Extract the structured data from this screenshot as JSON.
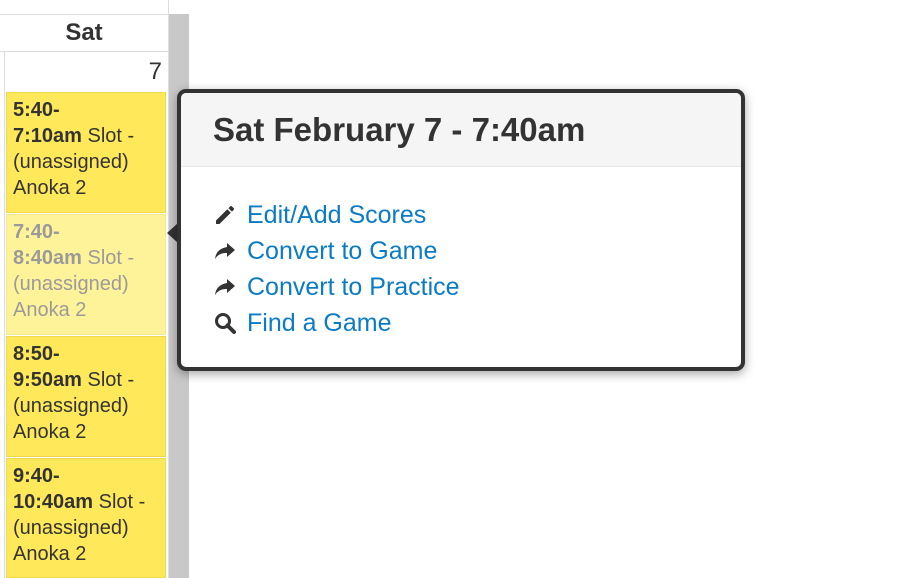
{
  "calendar": {
    "day_header": "Sat",
    "day_number": "7",
    "events": [
      {
        "time": "5:40-7:10am",
        "time_l1": "5:40-",
        "time_l2": "7:10am",
        "label": "Slot -",
        "status": "(unassigned)",
        "location": "Anoka 2"
      },
      {
        "time": "7:40-8:40am",
        "time_l1": "7:40-",
        "time_l2": "8:40am",
        "label": "Slot -",
        "status": "(unassigned)",
        "location": "Anoka 2"
      },
      {
        "time": "8:50-9:50am",
        "time_l1": "8:50-",
        "time_l2": "9:50am",
        "label": "Slot -",
        "status": "(unassigned)",
        "location": "Anoka 2"
      },
      {
        "time": "9:40-10:40am",
        "time_l1": "9:40-",
        "time_l2": "10:40am",
        "label": "Slot -",
        "status": "(unassigned)",
        "location": "Anoka 2"
      }
    ]
  },
  "popover": {
    "title": "Sat February 7 - 7:40am",
    "actions": [
      {
        "label": "Edit/Add Scores",
        "icon": "pencil-icon"
      },
      {
        "label": "Convert to Game",
        "icon": "share-arrow-icon"
      },
      {
        "label": "Convert to Practice",
        "icon": "share-arrow-icon"
      },
      {
        "label": "Find a Game",
        "icon": "search-icon"
      }
    ],
    "link_color": "#0a7bc4"
  }
}
